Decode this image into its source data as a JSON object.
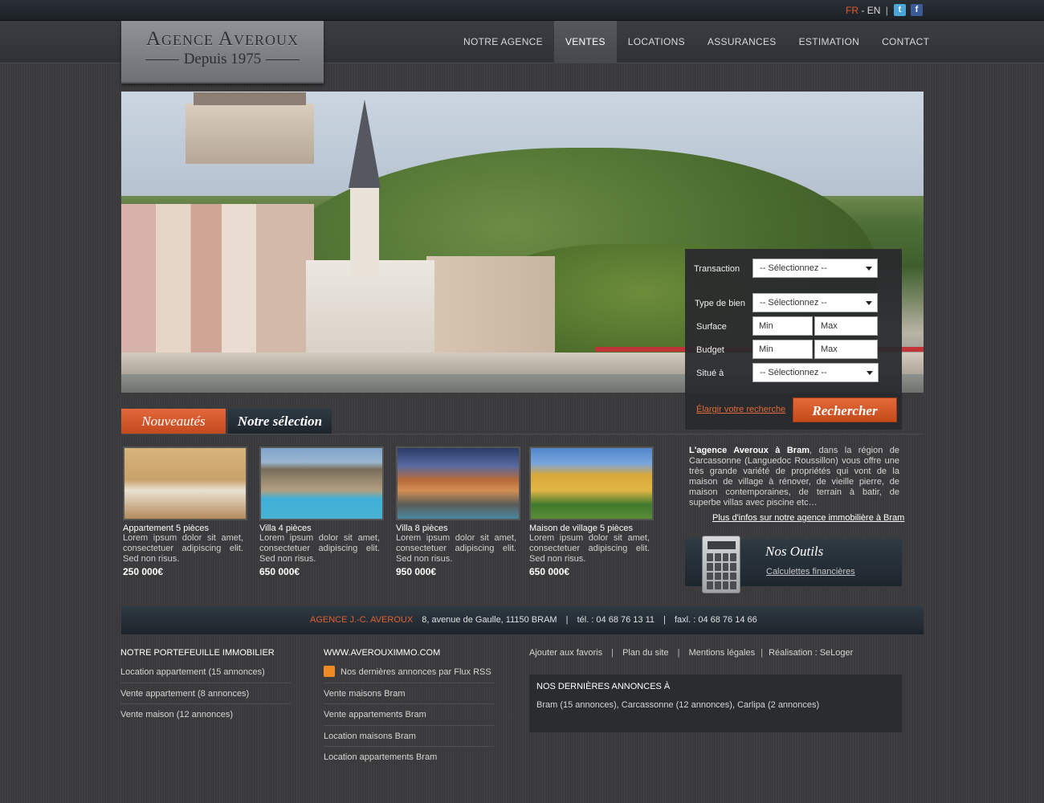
{
  "topbar": {
    "lang_fr": "FR",
    "lang_sep": "-",
    "lang_en": "EN",
    "divider": "|",
    "twitter": "t",
    "facebook": "f"
  },
  "logo": {
    "line1": "Agence Averoux",
    "line2": "Depuis 1975"
  },
  "nav": [
    {
      "label": "NOTRE AGENCE",
      "active": false
    },
    {
      "label": "VENTES",
      "active": true
    },
    {
      "label": "LOCATIONS",
      "active": false
    },
    {
      "label": "ASSURANCES",
      "active": false
    },
    {
      "label": "ESTIMATION",
      "active": false
    },
    {
      "label": "CONTACT",
      "active": false
    }
  ],
  "search": {
    "transaction_label": "Transaction",
    "transaction_value": "-- Sélectionnez --",
    "type_label": "Type de bien",
    "type_value": "-- Sélectionnez --",
    "surface_label": "Surface",
    "surface_min": "Min",
    "surface_max": "Max",
    "budget_label": "Budget",
    "budget_min": "Min",
    "budget_max": "Max",
    "situe_label": "Situé à",
    "situe_value": "-- Sélectionnez --",
    "elargir": "Élargir votre recherche",
    "submit": "Rechercher"
  },
  "tabs": {
    "tab1": "Nouveautés",
    "tab2": "Notre sélection"
  },
  "listings": [
    {
      "title": "Appartement 5 pièces",
      "desc": "Lorem ipsum dolor sit amet, consectetuer adipiscing elit. Sed non risus.",
      "price": "250 000€"
    },
    {
      "title": "Villa 4 pièces",
      "desc": "Lorem ipsum dolor sit amet, consectetuer adipiscing elit. Sed non risus.",
      "price": "650 000€"
    },
    {
      "title": "Villa 8 pièces",
      "desc": "Lorem ipsum dolor sit amet, consectetuer adipiscing elit. Sed non risus.",
      "price": "950 000€"
    },
    {
      "title": "Maison de village 5 pièces",
      "desc": "Lorem ipsum dolor sit amet, consectetuer adipiscing elit. Sed non risus.",
      "price": "650 000€"
    }
  ],
  "about": {
    "bold": "L'agence Averoux à Bram",
    "text": ", dans la région de Carcassonne (Languedoc Roussillon) vous offre une très grande variété de propriétés qui vont de la maison de village à rénover, de vieille pierre, de maison contemporaines, de terrain à batir, de superbe villas avec piscine etc…",
    "link": "Plus d'infos sur notre agence immobilière à Bram"
  },
  "outils": {
    "title": "Nos Outils",
    "link": "Calculettes financières"
  },
  "footer_bar": {
    "agence": "AGENCE J.-C. AVEROUX",
    "address": "8, avenue de Gaulle, 11150 BRAM",
    "tel": "tél. : 04 68 76 13 11",
    "fax": "faxl. : 04 68 76 14 66",
    "sep": "|"
  },
  "portefeuille": {
    "title": "NOTRE PORTEFEUILLE IMMOBILIER",
    "items": [
      "Location appartement (15 annonces)",
      "Vente appartement (8 annonces)",
      "Vente maison (12 annonces)"
    ]
  },
  "site": {
    "title": "WWW.AVEROUXIMMO.COM",
    "rss": "Nos dernières annonces par Flux RSS",
    "items": [
      "Vente maisons Bram",
      "Vente appartements Bram",
      "Location maisons Bram",
      "Location appartements Bram"
    ]
  },
  "footer_links": {
    "favoris": "Ajouter aux favoris",
    "plan": "Plan du site",
    "mentions": "Mentions légales",
    "realisation": "Réalisation : SeLoger",
    "pipe": "|"
  },
  "annonces": {
    "title": "NOS DERNIÈRES ANNONCES À",
    "value": "Bram (15 annonces), Carcassonne (12 annonces), Carlipa (2 annonces)"
  },
  "colors": {
    "accent": "#e05a2a",
    "dark_panel": "#2f3a44"
  }
}
